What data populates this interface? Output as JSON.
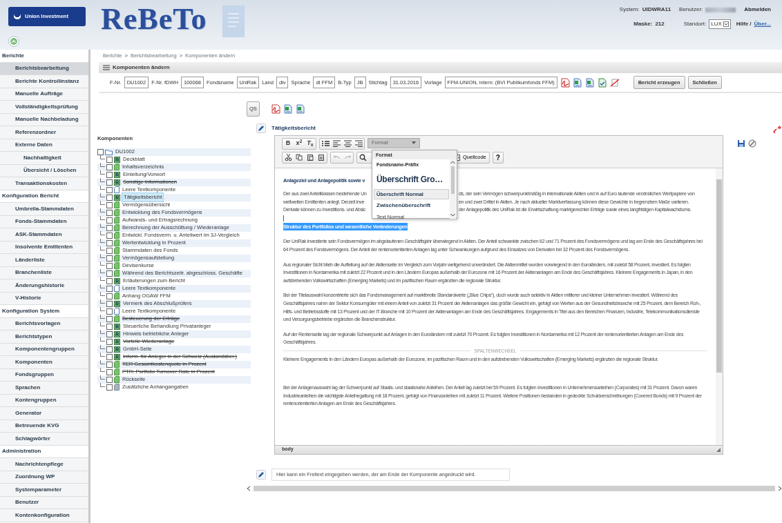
{
  "header": {
    "logo_text": "Union Investment",
    "app_title": "ReBeTo",
    "system_label": "System:",
    "system_value": "UIDWRA11",
    "user_label": "Benutzer:",
    "logout": "Abmelden",
    "mask_label": "Maske:",
    "mask_value": "212",
    "location_label": "Standort:",
    "location_value": "LUX",
    "help_text": "Hilfe /",
    "about_link": "Über..."
  },
  "sidebar": {
    "items": [
      {
        "label": "Berichte",
        "kind": "section",
        "selected": false
      },
      {
        "label": "Berichtsbearbeitung",
        "kind": "item",
        "selected": true
      },
      {
        "label": "Berichte Kontrollinstanz",
        "kind": "item",
        "selected": false
      },
      {
        "label": "Manuelle Aufträge",
        "kind": "item",
        "selected": false
      },
      {
        "label": "Vollständigkeitsprüfung",
        "kind": "item",
        "selected": false
      },
      {
        "label": "Manuelle Nachbeladung",
        "kind": "item",
        "selected": false
      },
      {
        "label": "Referenzordner",
        "kind": "item",
        "selected": false
      },
      {
        "label": "Externe Daten",
        "kind": "item",
        "selected": false
      },
      {
        "label": "Nachhaltigkeit",
        "kind": "subitem",
        "selected": false
      },
      {
        "label": "Übersicht / Löschen",
        "kind": "subitem",
        "selected": false
      },
      {
        "label": "Transaktionskosten",
        "kind": "item",
        "selected": false
      },
      {
        "label": "Konfiguration Bericht",
        "kind": "section",
        "selected": false
      },
      {
        "label": "Umbrella-Stammdaten",
        "kind": "item",
        "selected": false
      },
      {
        "label": "Fonds-Stammdaten",
        "kind": "item",
        "selected": false
      },
      {
        "label": "ASK-Stammdaten",
        "kind": "item",
        "selected": false
      },
      {
        "label": "Insolvente Emittenten",
        "kind": "item",
        "selected": false
      },
      {
        "label": "Länderliste",
        "kind": "item",
        "selected": false
      },
      {
        "label": "Branchenliste",
        "kind": "item",
        "selected": false
      },
      {
        "label": "Änderungshistorie",
        "kind": "item",
        "selected": false
      },
      {
        "label": "V-Historie",
        "kind": "item",
        "selected": false
      },
      {
        "label": "Konfiguration System",
        "kind": "section",
        "selected": false
      },
      {
        "label": "Berichtsvorlagen",
        "kind": "item",
        "selected": false
      },
      {
        "label": "Berichtstypen",
        "kind": "item",
        "selected": false
      },
      {
        "label": "Komponentengruppen",
        "kind": "item",
        "selected": false
      },
      {
        "label": "Komponenten",
        "kind": "item",
        "selected": false
      },
      {
        "label": "Fondsgruppen",
        "kind": "item",
        "selected": false
      },
      {
        "label": "Sprachen",
        "kind": "item",
        "selected": false
      },
      {
        "label": "Kontengruppen",
        "kind": "item",
        "selected": false
      },
      {
        "label": "Generator",
        "kind": "item",
        "selected": false
      },
      {
        "label": "Betreuende KVG",
        "kind": "item",
        "selected": false
      },
      {
        "label": "Schlagwörter",
        "kind": "item",
        "selected": false
      },
      {
        "label": "Administration",
        "kind": "section",
        "selected": false
      },
      {
        "label": "Nachrichtenpflege",
        "kind": "item",
        "selected": false
      },
      {
        "label": "Zuordnung WP",
        "kind": "item",
        "selected": false
      },
      {
        "label": "Systemparameter",
        "kind": "item",
        "selected": false
      },
      {
        "label": "Benutzer",
        "kind": "item",
        "selected": false
      },
      {
        "label": "Kontenkonfiguration",
        "kind": "item",
        "selected": false
      }
    ]
  },
  "breadcrumb": {
    "separator": ">",
    "items": [
      "Berichte",
      "Berichtsbearbeitung",
      "Komponenten ändern"
    ]
  },
  "panel_title": "Komponenten ändern",
  "filters": [
    {
      "label": "F-Nr.",
      "value": "DU1002"
    },
    {
      "label": "F-Nr. fDWH",
      "value": "100068"
    },
    {
      "label": "Fondsname",
      "value": "UniRak"
    },
    {
      "label": "Land",
      "value": "div"
    },
    {
      "label": "Sprache",
      "value": "dt FFM"
    },
    {
      "label": "B-Typ",
      "value": "JB"
    },
    {
      "label": "Stichtag",
      "value": "31.03.2016"
    },
    {
      "label": "Vorlage",
      "value": "FFM-UNION, intern: (BVI Publikumfonds FFM)"
    }
  ],
  "actions": [
    "Bericht erzeugen",
    "Schließen"
  ],
  "qs_button": "QS",
  "components": {
    "title": "Komponenten",
    "root": {
      "label": "DU1002",
      "checked": false,
      "children": [
        {
          "label": "Deckblatt",
          "kind": "report",
          "struck": false,
          "selected": false,
          "checked": false
        },
        {
          "label": "Inhaltsverzeichnis",
          "kind": "doc",
          "struck": false,
          "selected": false,
          "checked": false
        },
        {
          "label": "Einleitung/Vorwort",
          "kind": "report",
          "struck": false,
          "selected": false,
          "checked": false
        },
        {
          "label": "Sonstige Informationen",
          "kind": "report",
          "struck": true,
          "selected": false,
          "checked": false
        },
        {
          "label": "Leere Textkomponente",
          "kind": "blank",
          "struck": false,
          "selected": false,
          "checked": false
        },
        {
          "label": "Tätigkeitsbericht",
          "kind": "report",
          "struck": false,
          "selected": true,
          "checked": false
        },
        {
          "label": "Vermögensübersicht",
          "kind": "doc",
          "struck": false,
          "selected": false,
          "checked": false
        },
        {
          "label": "Entwicklung des Fondsvermögens",
          "kind": "doc",
          "struck": false,
          "selected": false,
          "checked": false
        },
        {
          "label": "Aufwands- und Ertragsrechnung",
          "kind": "doc",
          "struck": false,
          "selected": false,
          "checked": false
        },
        {
          "label": "Berechnung der Ausschüttung / Wiederanlage",
          "kind": "doc",
          "struck": false,
          "selected": false,
          "checked": false
        },
        {
          "label": "Entwickl. Fondsverm. u. Anteilwert im 3J-Vergleich",
          "kind": "doc",
          "struck": false,
          "selected": false,
          "checked": false
        },
        {
          "label": "Wertentwicklung in Prozent",
          "kind": "doc",
          "struck": false,
          "selected": false,
          "checked": false
        },
        {
          "label": "Stammdaten des Fonds",
          "kind": "doc",
          "struck": false,
          "selected": false,
          "checked": false
        },
        {
          "label": "Vermögensaufstellung",
          "kind": "doc",
          "struck": false,
          "selected": false,
          "checked": false
        },
        {
          "label": "Devisenkurse",
          "kind": "doc",
          "struck": false,
          "selected": false,
          "checked": false
        },
        {
          "label": "Während des Berichtszeitr. abgeschloss. Geschäfte",
          "kind": "doc",
          "struck": false,
          "selected": false,
          "checked": false
        },
        {
          "label": "Erläuterungen zum Bericht",
          "kind": "report",
          "struck": false,
          "selected": false,
          "checked": false
        },
        {
          "label": "Leere Textkomponente",
          "kind": "blank",
          "struck": false,
          "selected": false,
          "checked": false
        },
        {
          "label": "Anhang OGAW FFM",
          "kind": "doc",
          "struck": false,
          "selected": false,
          "checked": false
        },
        {
          "label": "Vermerk des Abschlußprüfers",
          "kind": "report",
          "struck": false,
          "selected": false,
          "checked": false
        },
        {
          "label": "Leere Textkomponente",
          "kind": "blank",
          "struck": false,
          "selected": false,
          "checked": false
        },
        {
          "label": "Besteuerung der Erträge",
          "kind": "doc",
          "struck": true,
          "selected": false,
          "checked": false
        },
        {
          "label": "Steuerliche Behandlung Privatanleger",
          "kind": "report",
          "struck": false,
          "selected": false,
          "checked": false
        },
        {
          "label": "Hinweis betriebliche Anleger",
          "kind": "report",
          "struck": false,
          "selected": false,
          "checked": false
        },
        {
          "label": "Vorteile Wiederanlage",
          "kind": "report",
          "struck": true,
          "selected": false,
          "checked": false
        },
        {
          "label": "GmbH-Seite",
          "kind": "report",
          "struck": false,
          "selected": false,
          "checked": false
        },
        {
          "label": "Inform. für Anleger in der Schweiz (Auslandsber.)",
          "kind": "report",
          "struck": true,
          "selected": false,
          "checked": false
        },
        {
          "label": "TER Gesamtkostenquote in Prozent",
          "kind": "doc",
          "struck": true,
          "selected": false,
          "checked": false
        },
        {
          "label": "PTR: Portfolio Turnover Rate in Prozent",
          "kind": "doc",
          "struck": true,
          "selected": false,
          "checked": false
        },
        {
          "label": "Rückseite",
          "kind": "doc",
          "struck": false,
          "selected": false,
          "checked": false
        },
        {
          "label": "Zusätzliche Anhangangaben",
          "kind": "grey",
          "struck": false,
          "selected": false,
          "checked": false
        }
      ]
    }
  },
  "editor": {
    "title": "Tätigkeitsbericht",
    "format_buttons": [
      "B",
      "x$^{2}$",
      "*T*$_{x}$"
    ],
    "history": [
      {
        "kind": "undo",
        "disabled": true
      },
      {
        "kind": "redo",
        "disabled": true
      }
    ],
    "format_select": "Format",
    "source_button": "Quellcode",
    "help_button": "?",
    "dropdown": {
      "header": "Format",
      "items": [
        {
          "label": "Fondsname-Präfix",
          "kind": "prefix",
          "selected": false
        },
        {
          "label": "Überschrift Gro…",
          "kind": "large",
          "selected": false
        },
        {
          "label": "Überschrift Normal",
          "kind": "heading",
          "selected": true
        },
        {
          "label": "Zwischenüberschrift",
          "kind": "subheading",
          "selected": false
        },
        {
          "label": "Text Normal",
          "kind": "text",
          "selected": false
        }
      ]
    },
    "heading_fragment": "Anlageziel und Anlagepolitik sowie v",
    "intro_lines": [
      {
        "left": "Der aus zwei Anteilklassen bestehende Un",
        "right": "ds, der sein Vermögen schwerpunktmäßig in internationale Aktien und in auf Euro lautende verzinslichen Wertpapiere von"
      },
      {
        "left": "weltweiten Emittenten anlegt. Derzeit inve",
        "right": "en und zwei Drittel in Aktien. Je nach aktueller Marktverfassung können diese Gewichte in begrenztem Maße variieren."
      },
      {
        "left": "Derivate können zu Investitions- und Absic",
        "right": "der Anlagepolitik des UniRak ist die Erwirtschaftung marktgerechter Erträge sowie eines langfristigen Kapitalwachstums."
      }
    ],
    "section_heading": {
      "text": "Struktur des Portfolios und wesentliche Veränderungen",
      "highlighted": true
    },
    "paragraphs": [
      "Der UniRak investierte sein Fondsvermögen im abgelaufenen Geschäftsjahr überwiegend in Aktien. Der Anteil schwankte zwischen 62 und 71 Prozent des Fondsvermögens und lag am Ende des Geschäftsjahres bei 64 Prozent des Fondsvermögens. Der Anteil der rentenorientierten Anlagen lag unter Schwankungen aufgrund des Einsatzes von Derivaten bei 32 Prozent des Fondsvermögens.",
      "Aus regionaler Sicht blieb die Aufteilung auf der Aktienseite im Vergleich zum Vorjahr weitgehend unverändert. Die Aktienmittel wurden vorwiegend in den Euroländern, mit zuletzt 58 Prozent, investiert. Es folgten Investitionen in Nordamerika mit zuletzt 22 Prozent und in den Ländern Europas außerhalb der Eurozone mit 16 Prozent der Aktienanlagen am Ende des Geschäftsjahres. Kleinere Engagements in Japan, in den aufstrebenden Volkswirtschaften (Emerging Markets) und im pazifischen Raum ergänzten die regionale Struktur.",
      "Bei der Titelauswahl konzentrierte sich das Fondsmanagement auf marktbreite Standardwerte („Blue Chips“), doch wurde auch selektiv in Aktien mittlerer und kleiner Unternehmen investiert. Während des Geschäftsjahres nahm der Sektor Konsumgüter mit einem Anteil von zuletzt 31 Prozent der Aktienanlagen das größte Gewicht ein, gefolgt von Werten aus der Gesundheitsbranche mit 25 Prozent, dem Bereich Roh-, Hilfs- und Betriebsstoffe mit 13 Prozent und der IT-Branche mit 10 Prozent der Aktienanlagen am Ende des Geschäftsjahres. Engagements in Titel aus den Bereichen Finanzen, Industrie, Telekommunikationsdienste und Versorgungsbetriebe ergänzten die Branchenstruktur.",
      "Auf der Rentenseite lag der regionale Schwerpunkt auf Anlagen in den Euroländern mit zuletzt 70 Prozent. Es folgten Investitionen in Nordamerika mit 12 Prozent der rentenorientierten Anlagen am Ende des Geschäftsjahres."
    ],
    "column_break": "SPALTENWECHSEL",
    "after_break": [
      "Kleinere Engagements in den Ländern Europas außerhalb der Eurozone, im pazifischen Raum und in den aufstrebenden Volkswirtschaften (Emerging Markets) ergänzten die regionale Struktur.",
      "Bei der Anlagenauswahl lag der Schwerpunkt auf Staats- und staatsnahe Anleihen. Der Anteil lag zuletzt bei 59 Prozent. Es folgten Investitionen in Unternehmensanleihen (Corporates) mit 31 Prozent. Davon waren Industrieanleihen die wichtigste Anleihegattung mit 18 Prozent, gefolgt von Finanzanleihen mit zuletzt 11 Prozent. Weitere Positionen bestanden in gedeckte Schuldverschreibungen (Covered Bonds) mit 9 Prozent der rentenorientierten Anlagen am Ende des Geschäftsjahres."
    ],
    "status_path": "body"
  },
  "freitext": {
    "value": "Hier kann ein Freitext eingegeben werden, der am Ende der Komponente angedruckt wird."
  }
}
